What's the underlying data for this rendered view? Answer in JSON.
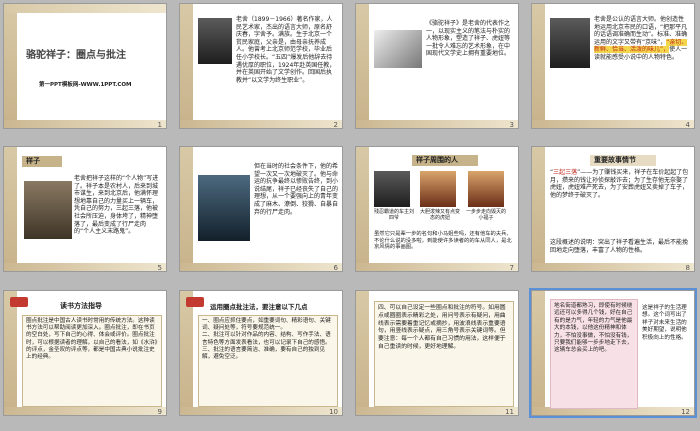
{
  "slides": [
    {
      "num": "1",
      "title": "骆驼祥子：圈点与批注",
      "footer": "第一PPT模板网-WWW.1PPT.COM"
    },
    {
      "num": "2",
      "text": "老舍（1899－1966）著名作家，人民艺术家，杰出的语言大师，原名舒庆春，字舍予。满族。生于北京一个贫民家庭，父亲是，由母亲抚养成人。他曾考上北京师范学校，毕业后任小学校长。“五四”爆发后他辞去待遇优厚的职位，1924年赴英国任教，并在英国开始了文学创作。回国后执教并“以文学为终生职业”。"
    },
    {
      "num": "3",
      "text": "《骆驼祥子》是老舍的代表作之一，以现实主义的笔法与朴实的人物形象，塑造了祥子、虎妞等一批令人难忘的艺术形象，在中国现代文学史上拥有重要地位。"
    },
    {
      "num": "4",
      "text_a": "老舍是公认的语言大师。他创造性地运用北京市民的口语，“把那平凡的话语调准确而生动”。标准、准确运用的文字又带有“京味”，",
      "highlight": "“亲切、新鲜、恰当、活泼的味儿”，",
      "text_b": "使人一读就能感受小说中的人物特色。"
    },
    {
      "num": "5",
      "title": "祥子",
      "text": "老舍把祥子这样的“个人物”写进了。祥子本是农村人，后来到城市谋生，来到北京后，他满怀理想地靠自己的力量买上一辆车，凭自己的努力，三起三落，他被社会所压迫，身体垮了，精神堕落了，最后变成了行尸走肉的“个人主义末路鬼”。"
    },
    {
      "num": "6",
      "text": "但在当时的社会条件下，他的希望一次又一次地破灭了。他与命运的抗争最终以惨败告终，到小说结尾，祥子已经丧失了自己的理想，从一个要强向上的青年变成了麻木、潦倒、狡猾、自暴自弃的行尸走肉。"
    },
    {
      "num": "7",
      "title": "祥子周围的人",
      "captions": [
        "残忍霸道的车主刘四爷",
        "大胆泼辣又有点变态的虎妞",
        "一步步走向毁灭的小福子"
      ],
      "text": "虽然它只是辈一步的名句和小马姐些吗，还有他车的夫兵、不论什么说的没多啦，到能使许多读者的的车从同人，是北京风情的事画图。"
    },
    {
      "num": "8",
      "title": "重要故事情节",
      "text_a": "“",
      "red": "三起三落",
      "text_b": "”——为了赚钱买来，祥子在车价起起了包月，攒来的钱让孙侦探敲诈去；为了生存他无奈娶了虎妞，虎妞难产死去，为了安葬虎妞又卖掉了车子，他的梦终于破灭了。",
      "text_c": "这段概述的说明：突出了祥子看遍生活，最后不能挽回地走向堕落，丰富了人物的性格。"
    },
    {
      "num": "9",
      "title": "读书方法指导",
      "text": "圈点批注是中国古人读书时常用的传统方法。这种读书方法可以帮助阅读更加深入。圈点批注，即在书页的空白处，写下自己的心得、体会或评价。圈点批注时，可以根据读者的理解，以自己的看法，如《水浒》的评点，金圣叹的评点等，都是中国古典小说批注史上的经典。"
    },
    {
      "num": "10",
      "title": "运用圈点批注法，要注意以下几点",
      "text": "一、圈点应抓住要点，如重要词句、精彩语句、关键词、疑问处等，符号要规范统一。\n二、批注可以针对作品的内容、结构、写作手法、语言特色等方面发表看法，也可以记录下自己的感悟。\n三、批注的语言要简洁、准确，要有自己的独到见解，避免空泛。"
    },
    {
      "num": "11",
      "text": "四、可以自己设定一些圈点和批注的符号。如用圆点或圈圈表示精彩之处，用问号表示有疑问，用曲线表示需要着重记忆或摘抄，用波浪线表示重要语句，用竖线表示疑点，用三角号表示关键词等。但要注意：每一个人都有自己习惯的用法，这样便于自己重读的时候，更好地理解。"
    },
    {
      "num": "12",
      "text": "地名街道都熟习，即使有时候绕远还可以多得几个钱，好在自己有的是力气，年轻的力气是他最大的本钱，以他这份精神和体力，不怕没事做，不怕没有钱，只要我们能够一步步地走下去，这辆车总会买上的吧。",
      "note": "这是祥子的生活理想。这个词写出了祥子对未来生活的美好期望，说明他积极向上的性格。"
    }
  ]
}
